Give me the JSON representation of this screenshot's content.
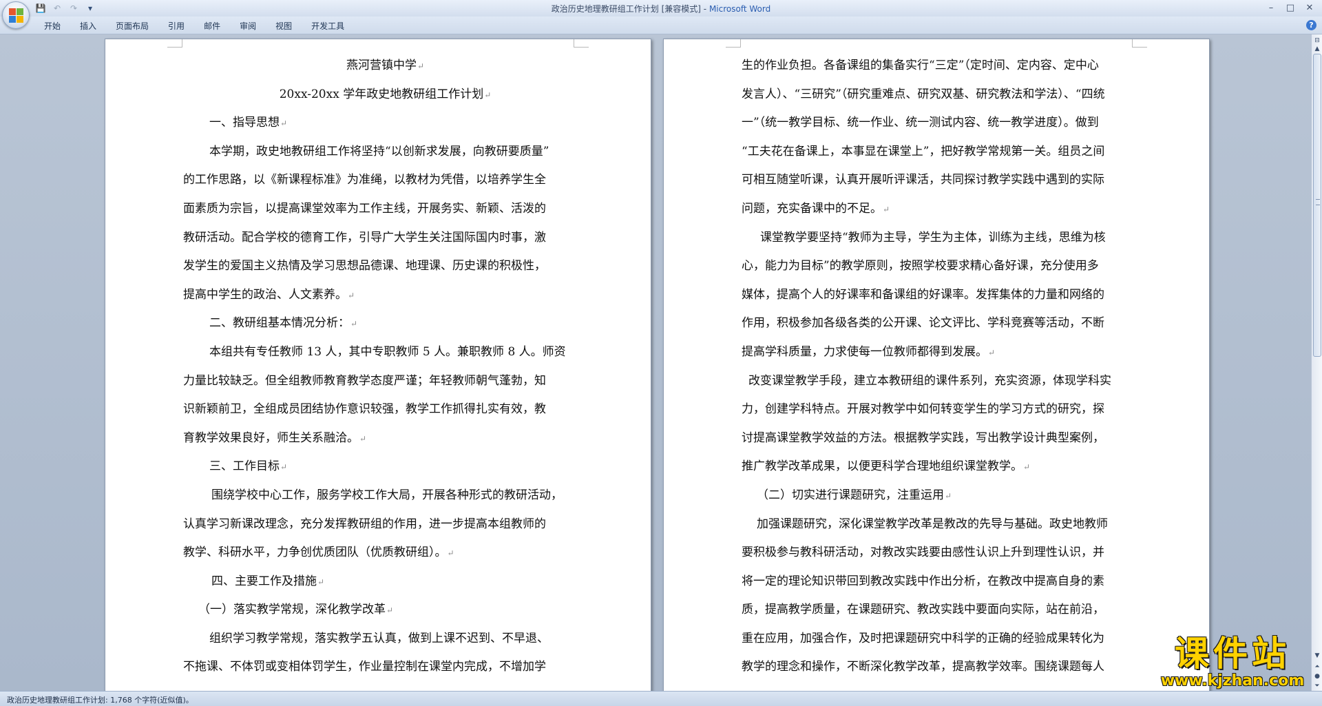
{
  "window": {
    "title": "政治历史地理教研组工作计划 [兼容模式]",
    "app_name": "Microsoft Word",
    "title_sep": " - "
  },
  "quick_access": {
    "icons": [
      "save-icon",
      "undo-icon",
      "redo-icon",
      "customize-icon"
    ],
    "glyphs": [
      "💾",
      "↶",
      "↷",
      "▾"
    ]
  },
  "window_controls": {
    "minimize": "–",
    "maximize": "□",
    "close": "✕"
  },
  "ribbon": {
    "tabs": [
      "开始",
      "插入",
      "页面布局",
      "引用",
      "邮件",
      "审阅",
      "视图",
      "开发工具"
    ],
    "help": "?"
  },
  "pilcrow": "↵",
  "document": {
    "left_page": [
      {
        "text": "燕河营镇中学",
        "style": "center",
        "mark": true
      },
      {
        "text": "20xx-20xx 学年政史地教研组工作计划",
        "style": "center",
        "mark": true
      },
      {
        "text": "一、指导思想",
        "style": "ind",
        "mark": true
      },
      {
        "text": "本学期，政史地教研组工作将坚持“以创新求发展，向教研要质量”",
        "style": "ind",
        "mark": false
      },
      {
        "text": "的工作思路，以《新课程标准》为准绳，以教材为凭借，以培养学生全",
        "style": "",
        "mark": false
      },
      {
        "text": "面素质为宗旨，以提高课堂效率为工作主线，开展务实、新颖、活泼的",
        "style": "",
        "mark": false
      },
      {
        "text": "教研活动。配合学校的德育工作，引导广大学生关注国际国内时事，激",
        "style": "",
        "mark": false
      },
      {
        "text": "发学生的爱国主义热情及学习思想品德课、地理课、历史课的积极性，",
        "style": "",
        "mark": false
      },
      {
        "text": "提高中学生的政治、人文素养。",
        "style": "",
        "mark": true
      },
      {
        "text": "二、教研组基本情况分析：",
        "style": "ind",
        "mark": true
      },
      {
        "text": "本组共有专任教师 13 人，其中专职教师 5 人。兼职教师 8 人。师资",
        "style": "ind",
        "mark": false
      },
      {
        "text": "力量比较缺乏。但全组教师教育教学态度严谨；年轻教师朝气蓬勃，知",
        "style": "",
        "mark": false
      },
      {
        "text": "识新颖前卫，全组成员团结协作意识较强，教学工作抓得扎实有效，教",
        "style": "",
        "mark": false
      },
      {
        "text": "育教学效果良好，师生关系融洽。",
        "style": "",
        "mark": true
      },
      {
        "text": "三、工作目标",
        "style": "ind",
        "mark": true
      },
      {
        "text": "围绕学校中心工作，服务学校工作大局，开展各种形式的教研活动，",
        "style": "ind-lg",
        "mark": false
      },
      {
        "text": "认真学习新课改理念，充分发挥教研组的作用，进一步提高本组教师的",
        "style": "",
        "mark": false
      },
      {
        "text": "教学、科研水平，力争创优质团队（优质教研组）。",
        "style": "",
        "mark": true
      },
      {
        "text": "四、主要工作及措施",
        "style": "ind-lg",
        "mark": true
      },
      {
        "text": "（一）落实教学常规，深化教学改革",
        "style": "ind-xs",
        "mark": true
      },
      {
        "text": "组织学习教学常规，落实教学五认真，做到上课不迟到、不早退、",
        "style": "ind",
        "mark": false
      },
      {
        "text": "不拖课、不体罚或变相体罚学生，作业量控制在课堂内完成，不增加学",
        "style": "",
        "mark": false
      }
    ],
    "right_page": [
      {
        "text": "生的作业负担。各备课组的集备实行“三定”（定时间、定内容、定中心",
        "style": "",
        "mark": false
      },
      {
        "text": "发言人）、“三研究”（研究重难点、研究双基、研究教法和学法）、“四统",
        "style": "",
        "mark": false
      },
      {
        "text": "一”（统一教学目标、统一作业、统一测试内容、统一教学进度）。做到",
        "style": "",
        "mark": false
      },
      {
        "text": "“工夫花在备课上，本事显在课堂上”，把好教学常规第一关。组员之间",
        "style": "",
        "mark": false
      },
      {
        "text": "可相互随堂听课，认真开展听评课活，共同探讨教学实践中遇到的实际",
        "style": "",
        "mark": false
      },
      {
        "text": "问题，充实备课中的不足。",
        "style": "",
        "mark": true
      },
      {
        "text": "课堂教学要坚持“教师为主导，学生为主体，训练为主线，思维为核",
        "style": "ind-md",
        "mark": false
      },
      {
        "text": "心，能力为目标”的教学原则，按照学校要求精心备好课，充分使用多",
        "style": "",
        "mark": false
      },
      {
        "text": "媒体，提高个人的好课率和备课组的好课率。发挥集体的力量和网络的",
        "style": "",
        "mark": false
      },
      {
        "text": "作用，积极参加各级各类的公开课、论文评比、学科竞赛等活动，不断",
        "style": "",
        "mark": false
      },
      {
        "text": "提高学科质量，力求使每一位教师都得到发展。",
        "style": "",
        "mark": true
      },
      {
        "text": "改变课堂教学手段，建立本教研组的课件系列，充实资源，体现学科实",
        "style": "ind-sm",
        "mark": false
      },
      {
        "text": "力，创建学科特点。开展对教学中如何转变学生的学习方式的研究，探",
        "style": "",
        "mark": false
      },
      {
        "text": "讨提高课堂教学效益的方法。根据教学实践，写出教学设计典型案例，",
        "style": "",
        "mark": false
      },
      {
        "text": "推广教学改革成果，以便更科学合理地组织课堂教学。",
        "style": "",
        "mark": true
      },
      {
        "text": "（二）切实进行课题研究，注重运用",
        "style": "ind-xs",
        "mark": true
      },
      {
        "text": "加强课题研究，深化课堂教学改革是教改的先导与基础。政史地教师",
        "style": "ind-xs",
        "mark": false
      },
      {
        "text": "要积极参与教科研活动，对教改实践要由感性认识上升到理性认识，并",
        "style": "",
        "mark": false
      },
      {
        "text": "将一定的理论知识带回到教改实践中作出分析，在教改中提高自身的素",
        "style": "",
        "mark": false
      },
      {
        "text": "质，提高教学质量，在课题研究、教改实践中要面向实际，站在前沿，",
        "style": "",
        "mark": false
      },
      {
        "text": "重在应用，加强合作，及时把课题研究中科学的正确的经验成果转化为",
        "style": "",
        "mark": false
      },
      {
        "text": "教学的理念和操作，不断深化教学改革，提高教学效率。围绕课题每人",
        "style": "",
        "mark": false
      }
    ]
  },
  "status_bar": {
    "text": "政治历史地理教研组工作计划: 1,768 个字符(近似值)。"
  },
  "watermark": {
    "title": "课件站",
    "url": "www.kjzhan.com"
  },
  "colors": {
    "accent": "#2a5db0",
    "watermark": "#ffd200"
  }
}
